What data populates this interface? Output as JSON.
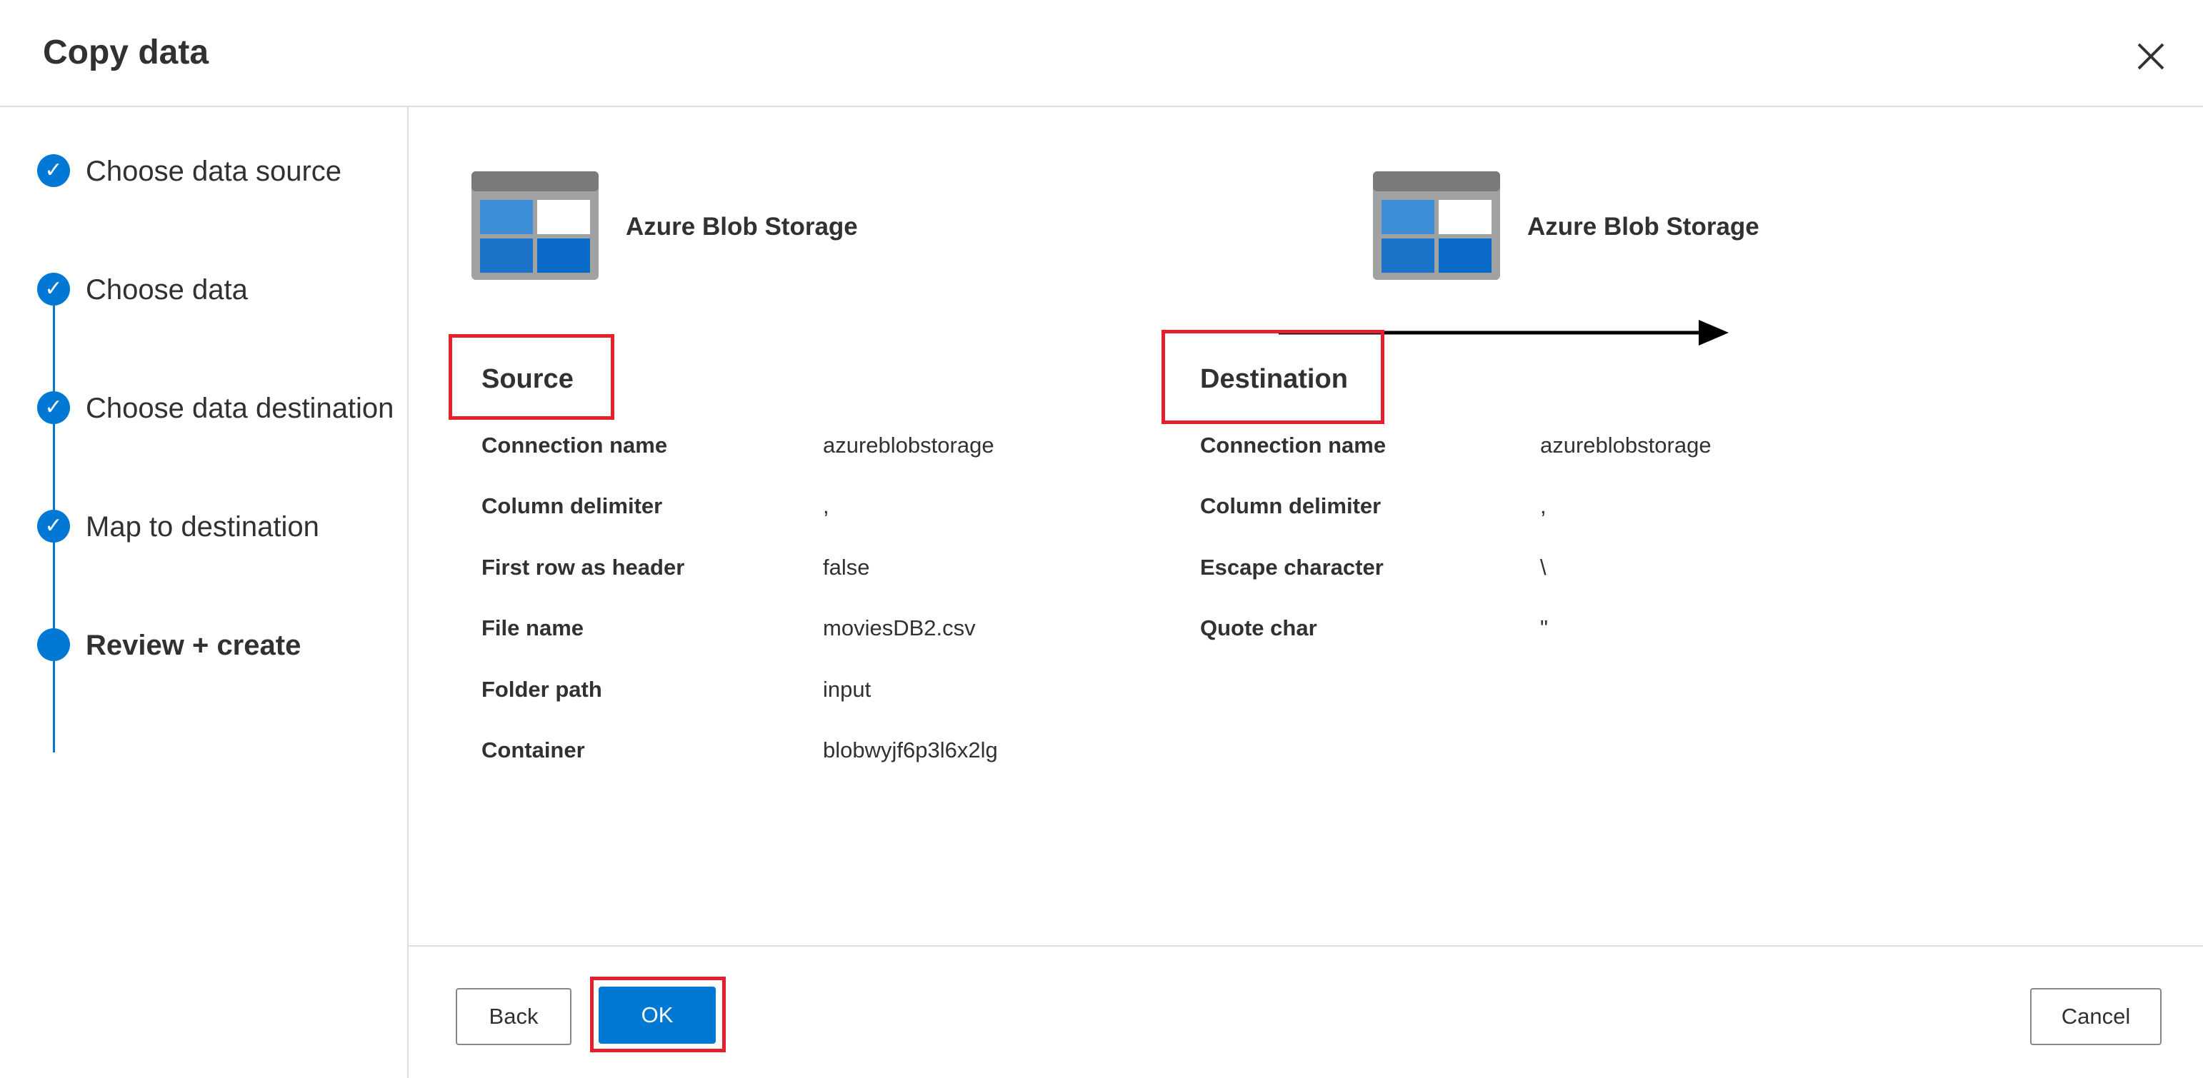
{
  "dialog": {
    "title": "Copy data"
  },
  "steps": [
    {
      "label": "Choose data source",
      "state": "complete"
    },
    {
      "label": "Choose data",
      "state": "complete"
    },
    {
      "label": "Choose data destination",
      "state": "complete"
    },
    {
      "label": "Map to destination",
      "state": "complete"
    },
    {
      "label": "Review + create",
      "state": "current"
    }
  ],
  "icons": {
    "step_complete": "✓"
  },
  "flow": {
    "source_name": "Azure Blob Storage",
    "destination_name": "Azure Blob Storage"
  },
  "source": {
    "title": "Source",
    "rows": [
      {
        "label": "Connection name",
        "value": "azureblobstorage"
      },
      {
        "label": "Column delimiter",
        "value": ","
      },
      {
        "label": "First row as header",
        "value": "false"
      },
      {
        "label": "File name",
        "value": "moviesDB2.csv"
      },
      {
        "label": "Folder path",
        "value": "input"
      },
      {
        "label": "Container",
        "value": "blobwyjf6p3l6x2lg"
      }
    ]
  },
  "destination": {
    "title": "Destination",
    "rows": [
      {
        "label": "Connection name",
        "value": "azureblobstorage"
      },
      {
        "label": "Column delimiter",
        "value": ","
      },
      {
        "label": "Escape character",
        "value": "\\"
      },
      {
        "label": "Quote char",
        "value": "\""
      }
    ]
  },
  "footer": {
    "back_label": "Back",
    "ok_label": "OK",
    "cancel_label": "Cancel"
  },
  "colors": {
    "accent": "#0078d4",
    "highlight": "#e3202e"
  }
}
